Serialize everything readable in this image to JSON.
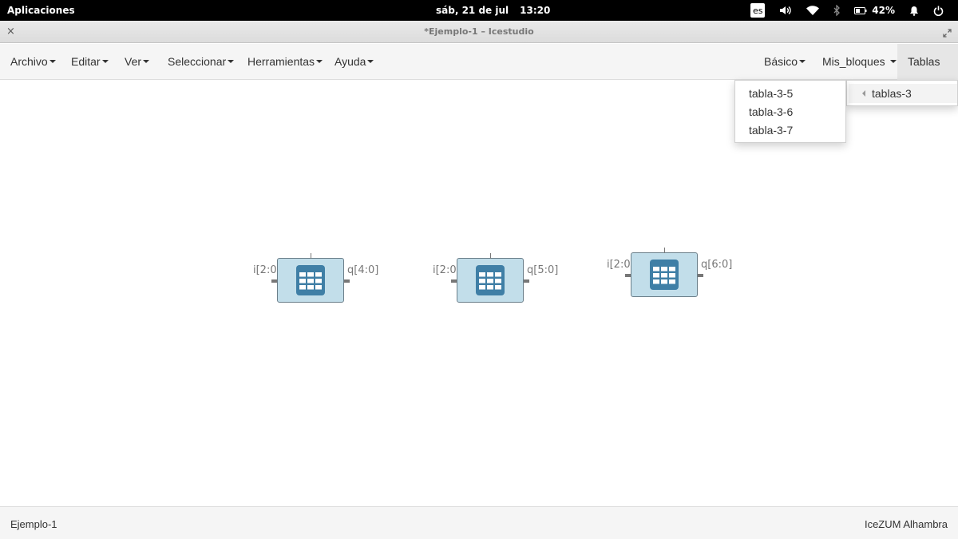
{
  "topbar": {
    "apps_label": "Aplicaciones",
    "date": "sáb, 21 de jul",
    "time": "13:20",
    "lang": "es",
    "battery": "42%",
    "icons": [
      "volume-icon",
      "wifi-icon",
      "bluetooth-icon",
      "battery-icon",
      "bell-icon",
      "power-icon"
    ]
  },
  "window": {
    "title": "*Ejemplo-1 – Icestudio",
    "close_glyph": "×"
  },
  "menubar": {
    "left": [
      "Archivo",
      "Editar",
      "Ver",
      "Seleccionar",
      "Herramientas",
      "Ayuda"
    ],
    "right": [
      "Básico",
      "Mis_bloques",
      "Tablas"
    ]
  },
  "tablas_menu": {
    "items": [
      "tablas-3"
    ]
  },
  "tablas3_submenu": {
    "items": [
      "tabla-3-5",
      "tabla-3-6",
      "tabla-3-7"
    ]
  },
  "blocks": [
    {
      "input": "i[2:0]",
      "output": "q[4:0]",
      "icon": "table-icon"
    },
    {
      "input": "i[2:0]",
      "output": "q[5:0]",
      "icon": "table-icon"
    },
    {
      "input": "i[2:0]",
      "output": "q[6:0]",
      "icon": "table-icon"
    }
  ],
  "status": {
    "project": "Ejemplo-1",
    "board": "IceZUM Alhambra"
  },
  "colors": {
    "block_fill": "#c2deea",
    "table_icon": "#3f7fa6",
    "topbar": "#000000"
  }
}
